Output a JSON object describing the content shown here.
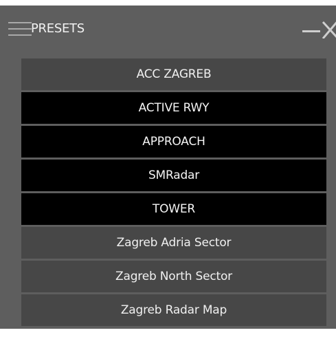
{
  "window": {
    "title": "PRESETS",
    "icons": {
      "menu": "hamburger-menu-icon",
      "minimize": "minimize-icon",
      "close": "close-icon"
    }
  },
  "presets": [
    {
      "label": "ACC ZAGREB",
      "style": "light"
    },
    {
      "label": "ACTIVE RWY",
      "style": "dark"
    },
    {
      "label": "APPROACH",
      "style": "dark"
    },
    {
      "label": "SMRadar",
      "style": "dark"
    },
    {
      "label": "TOWER",
      "style": "dark"
    },
    {
      "label": "Zagreb Adria Sector",
      "style": "light"
    },
    {
      "label": "Zagreb North Sector",
      "style": "light"
    },
    {
      "label": "Zagreb Radar Map",
      "style": "light"
    }
  ],
  "colors": {
    "window_bg": "#5e5e5e",
    "button_light": "#474747",
    "button_dark": "#000000",
    "text": "#f0f0f0"
  }
}
